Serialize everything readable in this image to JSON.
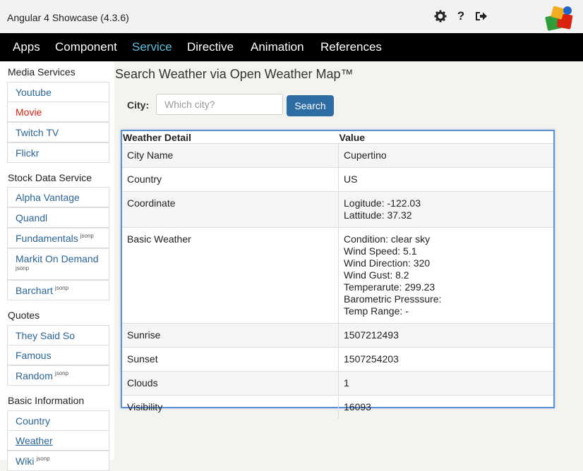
{
  "app": {
    "title": "Angular 4 Showcase (4.3.6)"
  },
  "toolbar_icons": [
    "gear-icon",
    "help-icon",
    "sign-out-icon"
  ],
  "nav": {
    "items": [
      "Apps",
      "Component",
      "Service",
      "Directive",
      "Animation",
      "References"
    ],
    "active": "Service",
    "active_color": "#5bc0de"
  },
  "sidebar": {
    "sections": [
      {
        "title": "Media Services",
        "items": [
          "Youtube",
          "Movie",
          "Twitch TV",
          "Flickr"
        ]
      },
      {
        "title": "Stock Data Service",
        "items": [
          "Alpha Vantage",
          "Quandl",
          "Fundamentals",
          "Markit On Demand",
          "Barchart"
        ]
      },
      {
        "title": "Quotes",
        "items": [
          "They Said So",
          "Famous",
          "Random"
        ]
      },
      {
        "title": "Basic Information",
        "items": [
          "Country",
          "Weather",
          "Wiki"
        ]
      }
    ],
    "tag": "jsonp"
  },
  "main": {
    "title": "Search Weather via Open Weather Map™",
    "city_label": "City:",
    "city_placeholder": "Which city?",
    "city_value": "",
    "search_label": "Search"
  },
  "table": {
    "headers": [
      "Weather Detail",
      "Value"
    ],
    "rows": [
      {
        "label": "City Name",
        "value": "Cupertino"
      },
      {
        "label": "Country",
        "value": "US"
      },
      {
        "label": "Coordinate",
        "value": "Logitude: -122.03\nLattitude: 37.32"
      },
      {
        "label": "Basic Weather",
        "value": "Condition: clear sky\nWind Speed: 5.1\nWind Direction: 320\nWind Gust: 8.2\nTemperarute: 299.23\nBarometric Presssure:\nTemp Range: -"
      },
      {
        "label": "Sunrise",
        "value": "1507212493"
      },
      {
        "label": "Sunset",
        "value": "1507254203"
      },
      {
        "label": "Clouds",
        "value": "1"
      },
      {
        "label": "Visibility",
        "value": "16093"
      }
    ]
  }
}
